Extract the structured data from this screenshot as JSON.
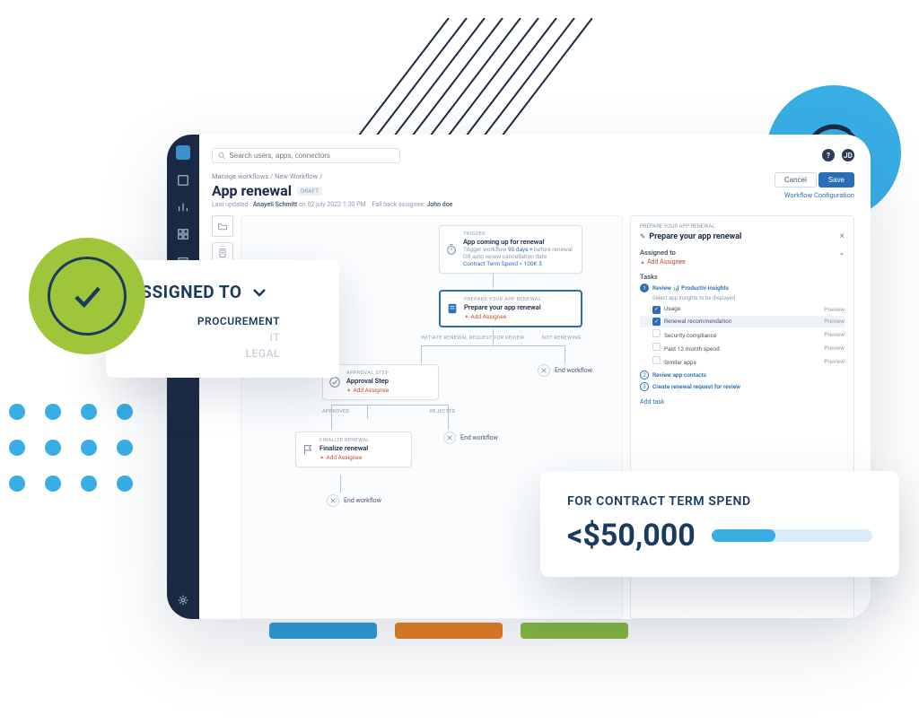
{
  "breadcrumb": {
    "a": "Manage workflows",
    "b": "New Workflow"
  },
  "page": {
    "title": "App renewal",
    "status_badge": "DRAFT",
    "last_updated_label": "Last updated :",
    "updated_by": "Anayeli Schmitt",
    "updated_when": "on 02 july 2022 1:30 PM",
    "fallback_label": "Fall back assignee:",
    "fallback_name": "John doe"
  },
  "search_placeholder": "Search users, apps, connectors",
  "buttons": {
    "cancel": "Cancel",
    "save": "Save"
  },
  "links": {
    "workflow_config": "Workflow Configuration"
  },
  "nodes": {
    "trigger": {
      "eyebrow": "TRIGGER",
      "title": "App coming up for renewal",
      "sub1_a": "Trigger workflow",
      "sub1_b": "90 days",
      "sub1_c": "before renewal",
      "sub2": "OR auto renew cancellation date",
      "sub3": "Contract Term Spend < 100K $"
    },
    "prepare": {
      "eyebrow": "PREPARE YOUR APP RENEWAL",
      "title": "Prepare your app renewal",
      "add": "Add Assignee"
    },
    "approval": {
      "eyebrow": "APPROVAL STEP",
      "title": "Approval Step",
      "add": "Add Assignee"
    },
    "finalize": {
      "eyebrow": "FINALIZE RENEWAL",
      "title": "Finalize renewal",
      "add": "Add Assignee"
    },
    "end1": "End workflow",
    "end2": "End workflow",
    "end3": "End workflow"
  },
  "branch_labels": {
    "initiate": "INITIATE RENEWAL REQUEST FOR REVIEW",
    "not_renewing": "NOT RENEWING",
    "approved": "APPROVED",
    "rejected": "REJECTED"
  },
  "panel": {
    "eyebrow": "PREPARE YOUR APP RENEWAL",
    "title": "Prepare your app renewal",
    "assigned_to_label": "Assigned to",
    "assigned_to_add": "Add Assignee",
    "tasks_label": "Tasks",
    "task1": {
      "num": "1",
      "label": "Review",
      "suffix": "Productiv insights"
    },
    "insights_sub": "Select app insights to be displayed",
    "opts": [
      {
        "label": "Usage",
        "preview": "Preview"
      },
      {
        "label": "Renewal recommendation",
        "preview": "Preview"
      },
      {
        "label": "Security compliance",
        "preview": "Preview"
      },
      {
        "label": "Past 12 month spend",
        "preview": "Preview"
      },
      {
        "label": "Similar apps",
        "preview": "Preview"
      }
    ],
    "task2": {
      "num": "2",
      "label": "Review app contacts"
    },
    "task3": {
      "num": "3",
      "label": "Create renewal request for review"
    },
    "add_task": "Add task"
  },
  "overlay_assigned": {
    "title": "ASSIGNED TO",
    "options": [
      "PROCUREMENT",
      "IT",
      "LEGAL"
    ]
  },
  "overlay_spend": {
    "label": "FOR CONTRACT TERM SPEND",
    "amount_prefix": "<",
    "amount": "$50,000"
  }
}
